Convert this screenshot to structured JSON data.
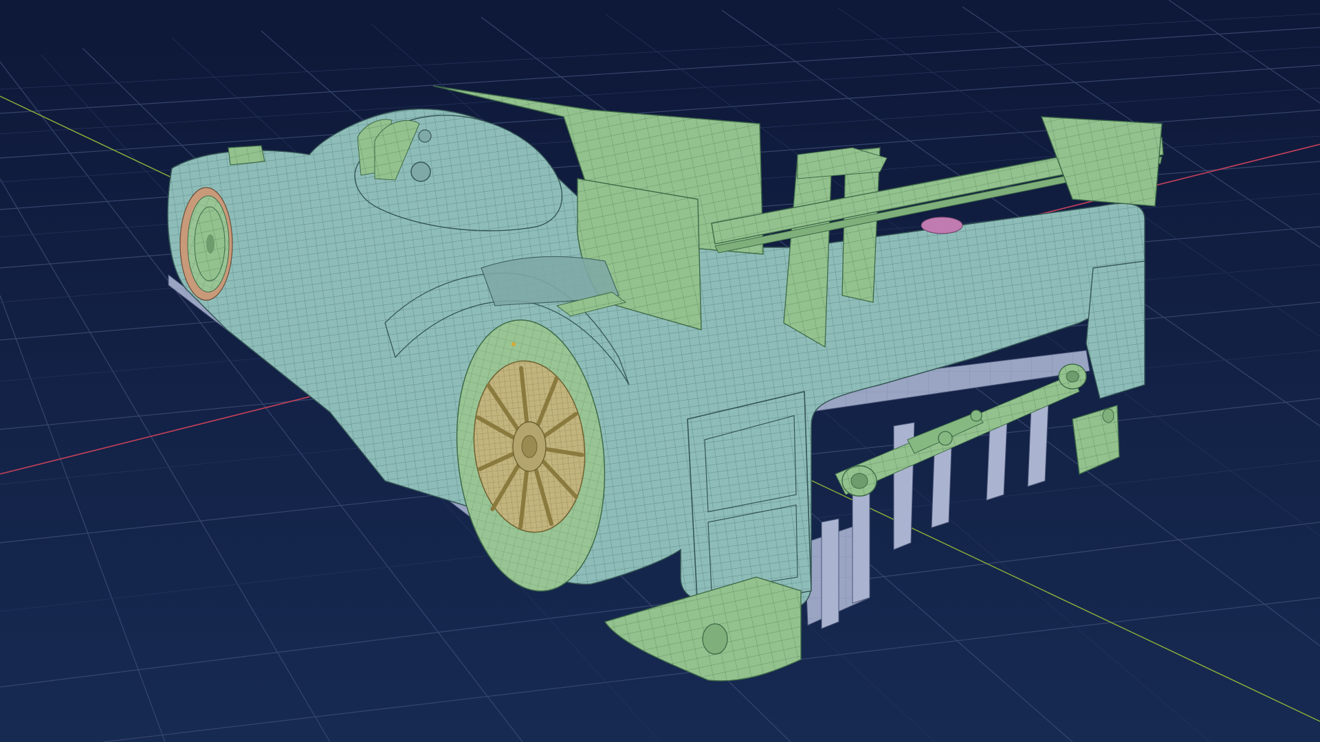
{
  "viewport": {
    "background_top": "#0f1a3c",
    "background_bottom": "#17284f",
    "grid_color": "#3b4a72",
    "axis_x_color": "#c2405a",
    "axis_y_color": "#8fb338"
  },
  "model": {
    "body_color": "#8ebdb9",
    "part_color": "#93c28e",
    "wheel_color": "#c2b47d",
    "tire_color": "#99c595",
    "rear_tire_rim_color": "#c99a7a",
    "diffuser_color": "#9aa4c3",
    "wire_color": "#3f6668",
    "accent_color": "#c07bb0"
  }
}
